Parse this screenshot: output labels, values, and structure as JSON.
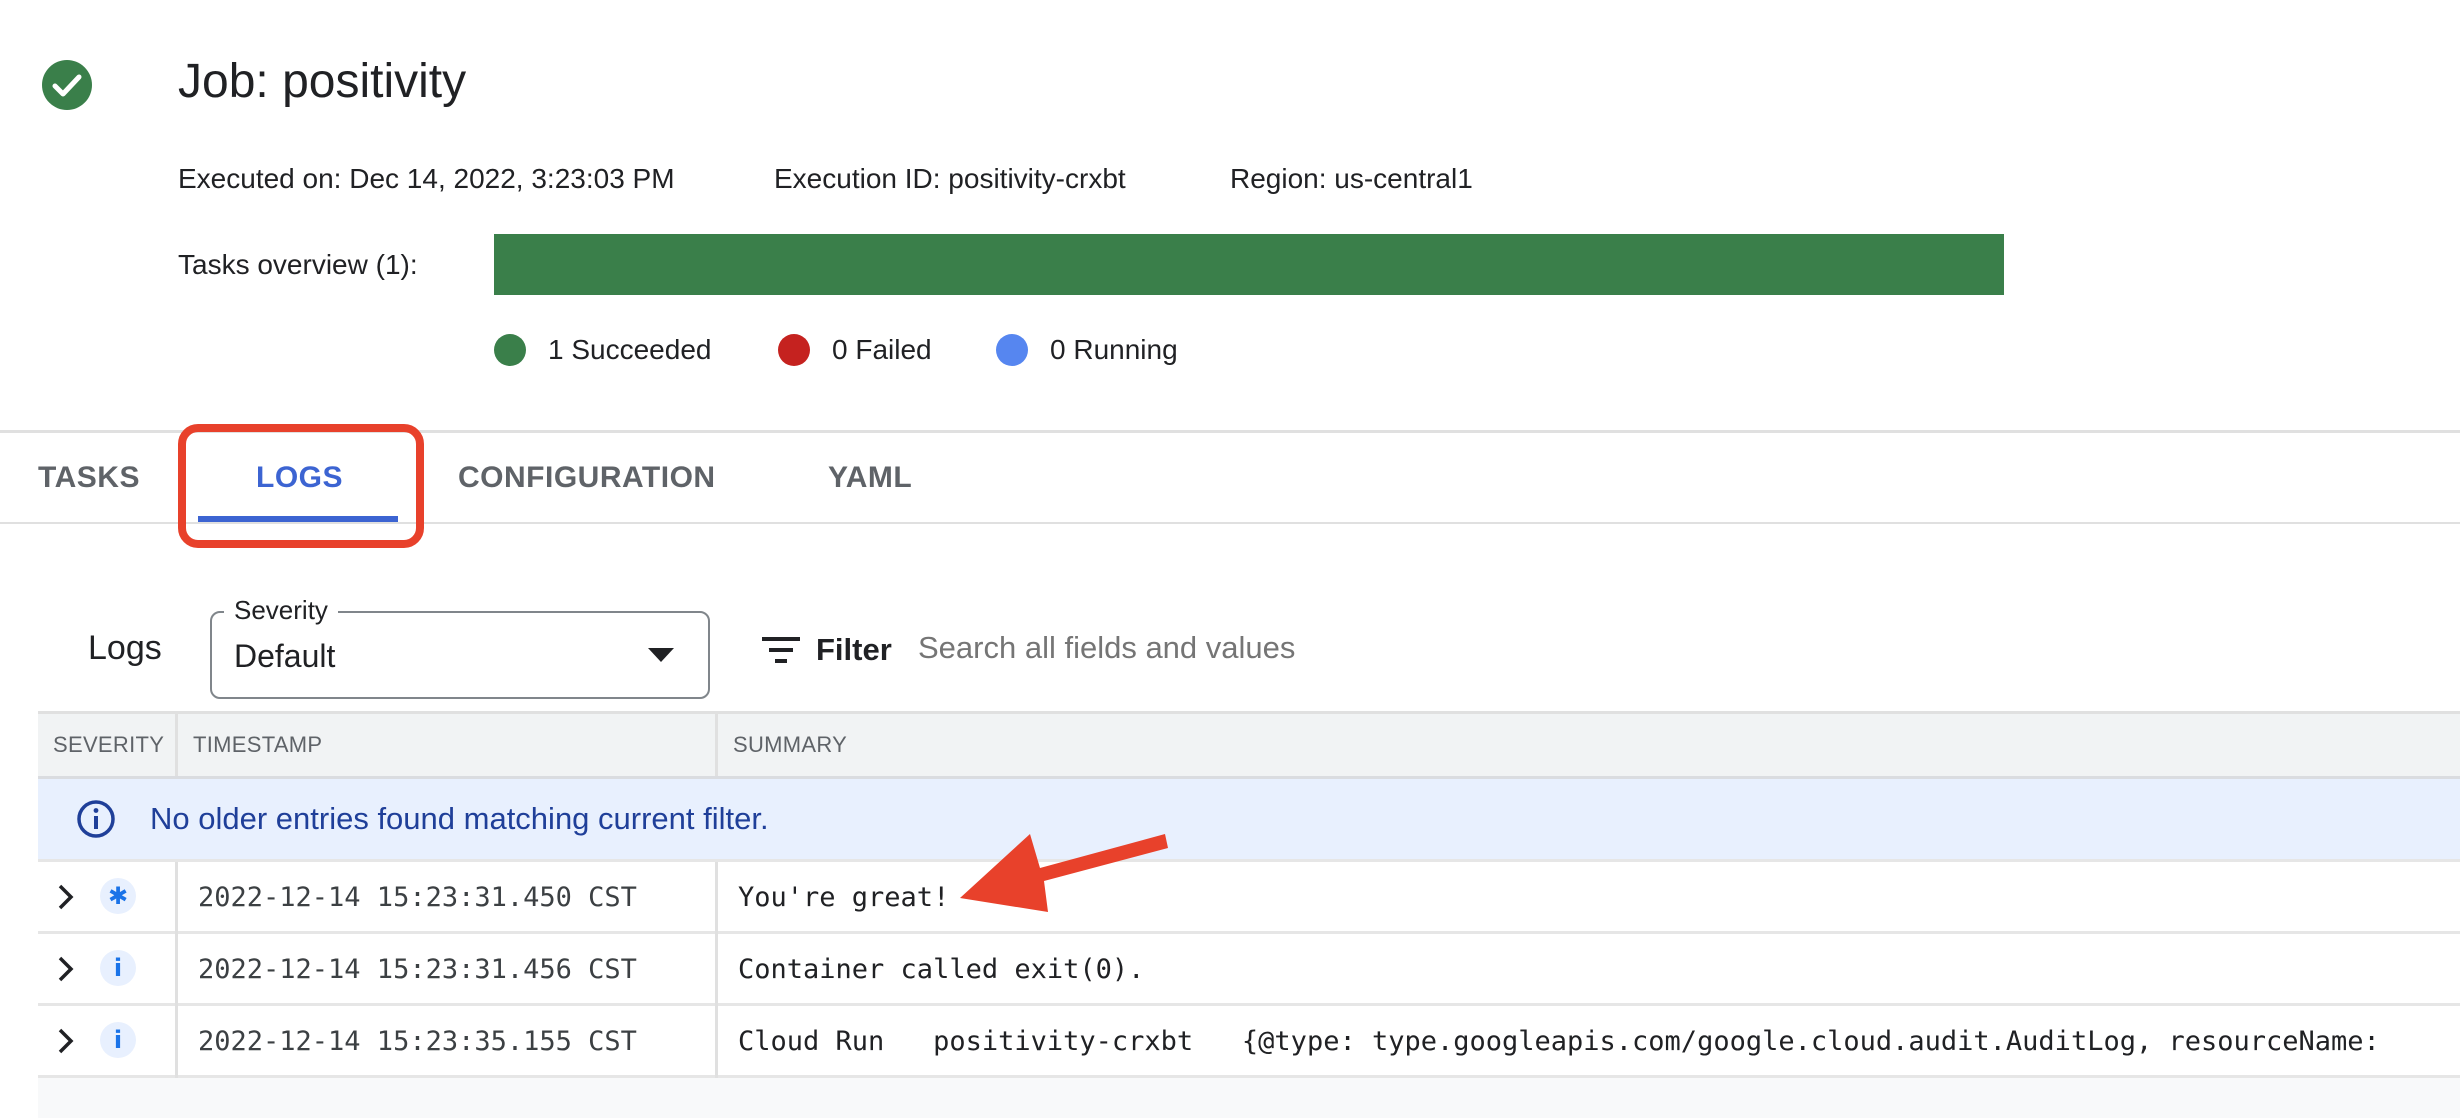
{
  "header": {
    "title": "Job: positivity",
    "status": "succeeded",
    "status_icon": "check-circle-icon",
    "status_color": "#3a7f4a",
    "executed_on": "Executed on: Dec 14, 2022, 3:23:03 PM",
    "execution_id": "Execution ID: positivity-crxbt",
    "region": "Region: us-central1"
  },
  "tasks_overview": {
    "label": "Tasks overview (1):",
    "succeeded_fraction": 1.0,
    "legend": [
      {
        "label": "1 Succeeded",
        "color": "#3a7f4a"
      },
      {
        "label": "0 Failed",
        "color": "#c5221f"
      },
      {
        "label": "0 Running",
        "color": "#5686f0"
      }
    ]
  },
  "tabs": [
    {
      "label": "TASKS",
      "active": false
    },
    {
      "label": "LOGS",
      "active": true
    },
    {
      "label": "CONFIGURATION",
      "active": false
    },
    {
      "label": "YAML",
      "active": false
    }
  ],
  "logs": {
    "title": "Logs",
    "severity": {
      "label": "Severity",
      "value": "Default"
    },
    "filter_label": "Filter",
    "search_placeholder": "Search all fields and values",
    "search_value": "",
    "columns": [
      "SEVERITY",
      "TIMESTAMP",
      "SUMMARY"
    ],
    "info_banner": "No older entries found matching current filter.",
    "entries": [
      {
        "severity": "default",
        "severity_glyph": "✱",
        "timestamp": "2022-12-14 15:23:31.450 CST",
        "summary": "You're great!"
      },
      {
        "severity": "info",
        "severity_glyph": "i",
        "timestamp": "2022-12-14 15:23:31.456 CST",
        "summary": "Container called exit(0)."
      },
      {
        "severity": "info",
        "severity_glyph": "i",
        "timestamp": "2022-12-14 15:23:35.155 CST",
        "summary": "Cloud Run   positivity-crxbt   {@type: type.googleapis.com/google.cloud.audit.AuditLog, resourceName:"
      }
    ]
  },
  "colors": {
    "accent": "#3c64d2",
    "annotation": "#e8412b",
    "banner_bg": "#e8f0fe",
    "banner_text": "#1f3f99"
  }
}
